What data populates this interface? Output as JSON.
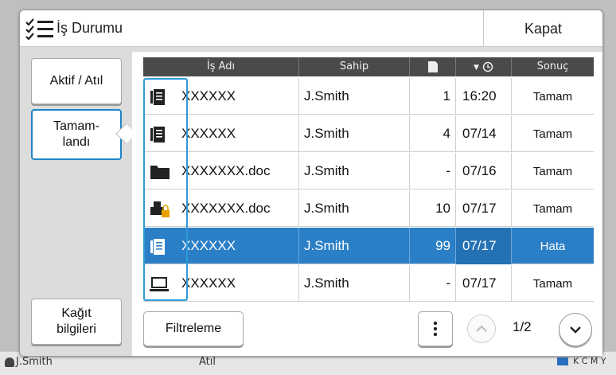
{
  "background": {
    "user": "J.Smith",
    "middle": "Atıl",
    "indicators": "K  C  M  Y"
  },
  "title": "İş Durumu",
  "close_label": "Kapat",
  "left_buttons": {
    "active": "Aktif / Atıl",
    "done_line1": "Tamam-",
    "done_line2": "landı",
    "paper_line1": "Kağıt",
    "paper_line2": "bilgileri"
  },
  "columns": {
    "name": "İş Adı",
    "owner": "Sahip",
    "result": "Sonuç"
  },
  "rows": [
    {
      "icon": "document-icon",
      "name": "XXXXXX",
      "owner": "J.Smith",
      "pages": "1",
      "time": "16:20",
      "result": "Tamam"
    },
    {
      "icon": "document-icon",
      "name": "XXXXXX",
      "owner": "J.Smith",
      "pages": "4",
      "time": "07/14",
      "result": "Tamam"
    },
    {
      "icon": "folder-icon",
      "name": "XXXXXXX.doc",
      "owner": "J.Smith",
      "pages": "-",
      "time": "07/16",
      "result": "Tamam"
    },
    {
      "icon": "locked-printer-icon",
      "name": "XXXXXXX.doc",
      "owner": "J.Smith",
      "pages": "10",
      "time": "07/17",
      "result": "Tamam"
    },
    {
      "icon": "document-icon",
      "name": "XXXXXX",
      "owner": "J.Smith",
      "pages": "99",
      "time": "07/17",
      "result": "Hata"
    },
    {
      "icon": "computer-icon",
      "name": "XXXXXX",
      "owner": "J.Smith",
      "pages": "-",
      "time": "07/17",
      "result": "Tamam"
    }
  ],
  "filter_label": "Filtreleme",
  "page_indicator": "1/2",
  "colors": {
    "accent": "#1e86c8",
    "selected_row": "#2b7fc6",
    "header": "#4a4a4a"
  }
}
